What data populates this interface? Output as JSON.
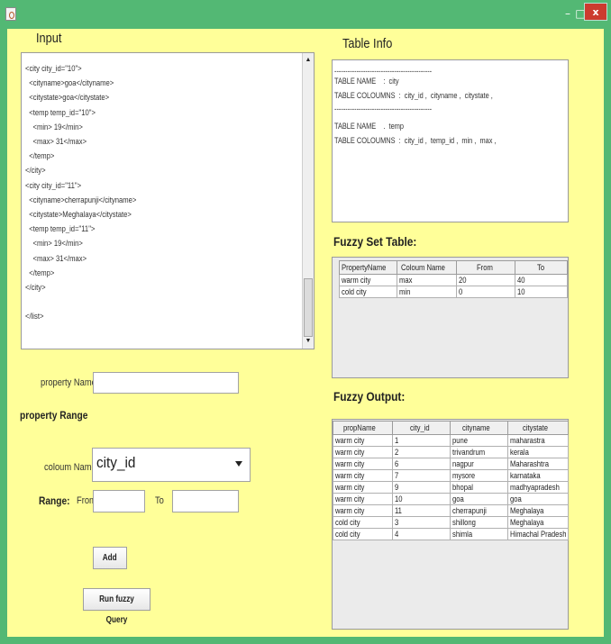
{
  "window": {
    "close_label": "x",
    "minimize_label": "–",
    "maximize_label": "□"
  },
  "input_section": {
    "title": "Input",
    "xml_lines": [
      "<city city_id=\"10\">",
      "  <cityname>goa</cityname>",
      "  <citystate>goa</citystate>",
      "  <temp temp_id=\"10\">",
      "    <min> 19</min>",
      "    <max> 31</max>",
      "  </temp>",
      "</city>",
      "<city city_id=\"11\">",
      "  <cityname>cherrapunji</cityname>",
      "  <citystate>Meghalaya</citystate>",
      "  <temp temp_id=\"11\">",
      "    <min> 19</min>",
      "    <max> 31</max>",
      "  </temp>",
      "</city>",
      "",
      "</list>"
    ]
  },
  "form": {
    "property_name_label": "property Name",
    "property_name_value": "",
    "property_range_label": "property Range",
    "column_name_label": "coloum Name",
    "column_name_value": "city_id",
    "range_label": "Range:",
    "from_label": "From",
    "from_value": "",
    "to_label": "To",
    "to_value": "",
    "add_button": "Add",
    "run_button": "Run fuzzy Query"
  },
  "table_info": {
    "title": "Table Info",
    "separator": "--------------------------------------------",
    "lines": [
      "TABLE NAME    :  city",
      "TABLE COLOUMNS  :  city_id ,  cityname ,  citystate ,",
      "TABLE NAME    .  temp",
      "TABLE COLOUMNS  :  city_id ,  temp_id ,  min ,  max ,"
    ]
  },
  "fuzzy_set_table": {
    "title": "Fuzzy Set Table:",
    "columns": [
      "PropertyName",
      "Coloum Name",
      "From",
      "To"
    ],
    "rows": [
      [
        "warm city",
        "max",
        "20",
        "40"
      ],
      [
        "cold city",
        "min",
        "0",
        "10"
      ]
    ]
  },
  "fuzzy_output": {
    "title": "Fuzzy Output:",
    "columns": [
      "propName",
      "city_id",
      "cityname",
      "citystate"
    ],
    "rows": [
      [
        "warm city",
        "1",
        "pune",
        "maharastra"
      ],
      [
        "warm city",
        "2",
        "trivandrum",
        "kerala"
      ],
      [
        "warm city",
        "6",
        "nagpur",
        "Maharashtra"
      ],
      [
        "warm city",
        "7",
        "mysore",
        "karnataka"
      ],
      [
        "warm city",
        "9",
        "bhopal",
        "madhyapradesh"
      ],
      [
        "warm city",
        "10",
        "goa",
        "goa"
      ],
      [
        "warm city",
        "11",
        "cherrapunji",
        "Meghalaya"
      ],
      [
        "cold city",
        "3",
        "shillong",
        "Meghalaya"
      ],
      [
        "cold city",
        "4",
        "shimla",
        "Himachal Pradesh"
      ]
    ]
  }
}
